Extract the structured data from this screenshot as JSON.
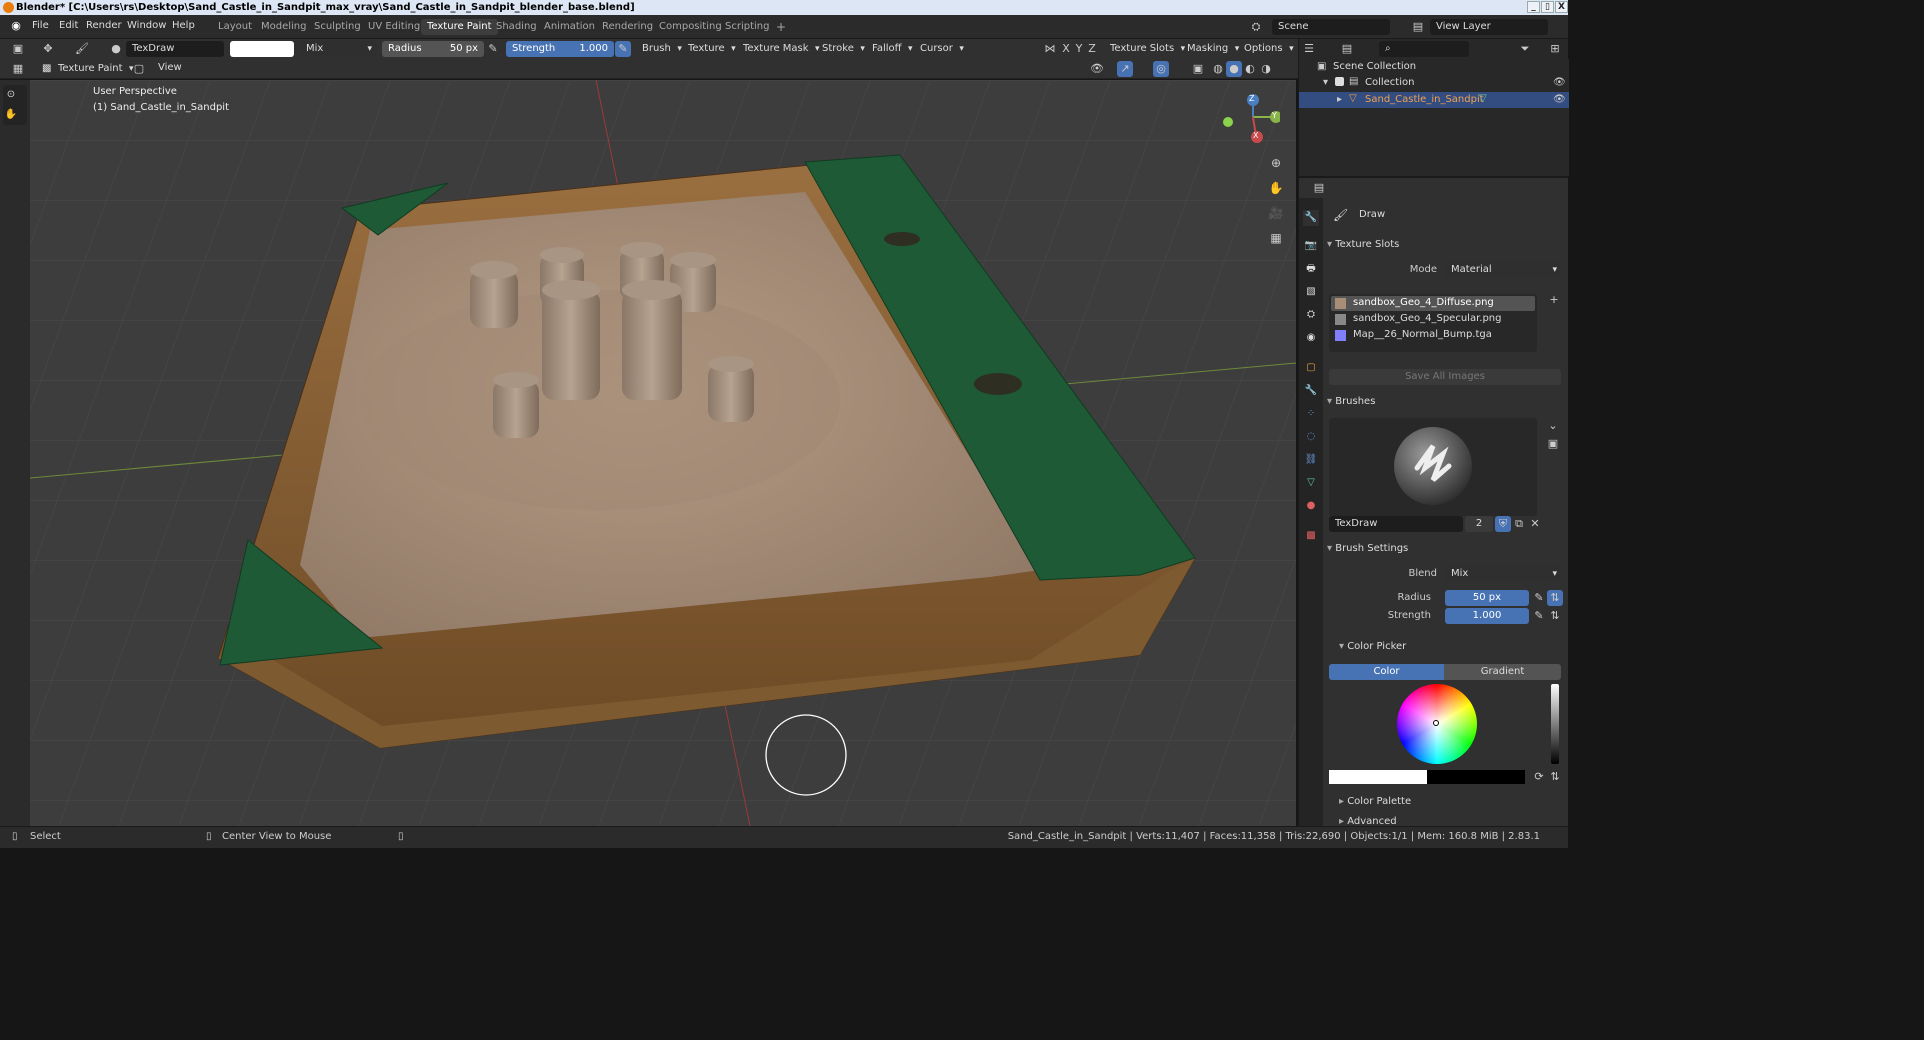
{
  "titlebar": {
    "title": "Blender* [C:\\Users\\rs\\Desktop\\Sand_Castle_in_Sandpit_max_vray\\Sand_Castle_in_Sandpit_blender_base.blend]",
    "min": "_",
    "max": "▯",
    "close": "X"
  },
  "menu": {
    "file": "File",
    "edit": "Edit",
    "render": "Render",
    "window": "Window",
    "help": "Help"
  },
  "workspaces": [
    "Layout",
    "Modeling",
    "Sculpting",
    "UV Editing",
    "Texture Paint",
    "Shading",
    "Animation",
    "Rendering",
    "Compositing",
    "Scripting"
  ],
  "workspace_add": "+",
  "scene": {
    "name": "Scene",
    "view_layer": "View Layer"
  },
  "toolheader": {
    "brush_name": "TexDraw",
    "blend": "Mix",
    "radius_label": "Radius",
    "radius_value": "50 px",
    "strength_label": "Strength",
    "strength_value": "1.000",
    "brush": "Brush",
    "texture": "Texture",
    "texture_mask": "Texture Mask",
    "stroke": "Stroke",
    "falloff": "Falloff",
    "cursor": "Cursor",
    "axis_x": "X",
    "axis_y": "Y",
    "axis_z": "Z",
    "texture_slots": "Texture Slots",
    "masking": "Masking",
    "options": "Options"
  },
  "viewheader": {
    "mode": "Texture Paint",
    "view": "View"
  },
  "viewport": {
    "perspective": "User Perspective",
    "object": "(1) Sand_Castle_in_Sandpit",
    "gizmo_x": "X",
    "gizmo_y": "Y",
    "gizmo_z": "Z"
  },
  "outliner": {
    "scene_collection": "Scene Collection",
    "collection": "Collection",
    "object": "Sand_Castle_in_Sandpit"
  },
  "properties": {
    "tool_name": "Draw",
    "texture_slots_title": "Texture Slots",
    "mode_label": "Mode",
    "mode_value": "Material",
    "slots": [
      "sandbox_Geo_4_Diffuse.png",
      "sandbox_Geo_4_Specular.png",
      "Map__26_Normal_Bump.tga"
    ],
    "save_all": "Save All Images",
    "brushes_title": "Brushes",
    "brush_name": "TexDraw",
    "brush_users": "2",
    "brush_settings_title": "Brush Settings",
    "blend_label": "Blend",
    "blend_value": "Mix",
    "radius_label": "Radius",
    "radius_value": "50 px",
    "strength_label": "Strength",
    "strength_value": "1.000",
    "color_picker_title": "Color Picker",
    "color_tab": "Color",
    "gradient_tab": "Gradient",
    "color_palette": "Color Palette",
    "advanced": "Advanced"
  },
  "statusbar": {
    "select": "Select",
    "center_view": "Center View to Mouse",
    "stats": "Sand_Castle_in_Sandpit | Verts:11,407 | Faces:11,358 | Tris:22,690 | Objects:1/1 | Mem: 160.8 MiB | 2.83.1"
  },
  "colors": {
    "accent": "#4772b3",
    "sand": "#a88e77",
    "wood": "#8a6236",
    "green": "#1e5a35",
    "header": "#303030"
  }
}
